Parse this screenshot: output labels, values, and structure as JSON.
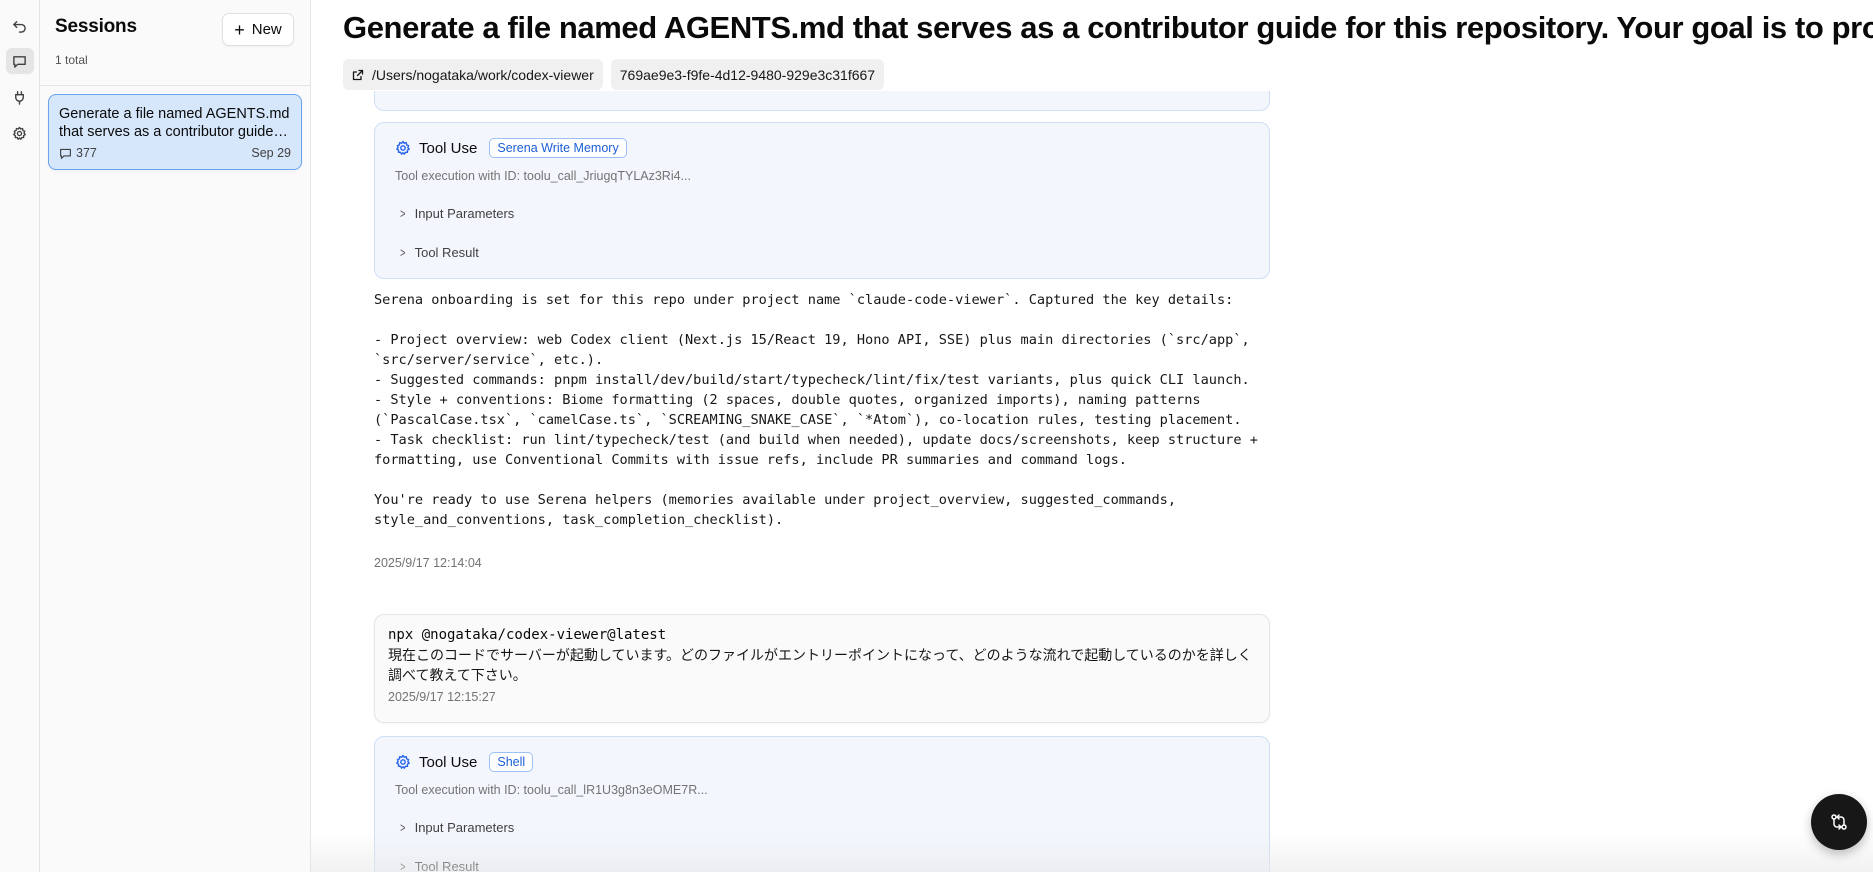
{
  "sidebar": {
    "title": "Sessions",
    "count": "1 total",
    "new_label": "New",
    "sessions": [
      {
        "title": "Generate a file named AGENTS.md that serves as a contributor guide for this repository. Your goal is to produce a clear, concise, and well-structured document",
        "message_count": "377",
        "date": "Sep 29"
      }
    ]
  },
  "header": {
    "title": "Generate a file named AGENTS.md that serves as a contributor guide for this repository. Your goal is to produce a clear, concise, and well-structured document",
    "path": "/Users/nogataka/work/codex-viewer",
    "session_id": "769ae9e3-f9fe-4d12-9480-929e3c31f667"
  },
  "messages": {
    "tool1": {
      "label": "Tool Use",
      "badge": "Serena Write Memory",
      "id_text": "Tool execution with ID: toolu_call_JriugqTYLAz3Ri4...",
      "input_label": "Input Parameters",
      "result_label": "Tool Result"
    },
    "assistant1": {
      "text": "Serena onboarding is set for this repo under project name `claude-code-viewer`. Captured the key details:\n\n- Project overview: web Codex client (Next.js 15/React 19, Hono API, SSE) plus main directories (`src/app`, `src/server/service`, etc.).\n- Suggested commands: pnpm install/dev/build/start/typecheck/lint/fix/test variants, plus quick CLI launch.\n- Style + conventions: Biome formatting (2 spaces, double quotes, organized imports), naming patterns (`PascalCase.tsx`, `camelCase.ts`, `SCREAMING_SNAKE_CASE`, `*Atom`), co-location rules, testing placement.\n- Task checklist: run lint/typecheck/test (and build when needed), update docs/screenshots, keep structure + formatting, use Conventional Commits with issue refs, include PR summaries and command logs.\n\nYou're ready to use Serena helpers (memories available under project_overview, suggested_commands, style_and_conventions, task_completion_checklist).",
      "time": "2025/9/17 12:14:04"
    },
    "user1": {
      "command": "npx @nogataka/codex-viewer@latest",
      "text": "現在このコードでサーバーが起動しています。どのファイルがエントリーポイントになって、どのような流れで起動しているのかを詳しく調べて教えて下さい。",
      "time": "2025/9/17 12:15:27"
    },
    "tool2": {
      "label": "Tool Use",
      "badge": "Shell",
      "id_text": "Tool execution with ID: toolu_call_lR1U3g8n3eOME7R...",
      "input_label": "Input Parameters",
      "result_label": "Tool Result"
    }
  },
  "icons": {
    "rail": [
      "undo-icon",
      "chat-icon",
      "plug-icon",
      "settings-icon"
    ],
    "fab": "git-compare-icon"
  },
  "colors": {
    "accent": "#2563eb",
    "selected_session_bg": "#d6e6fb",
    "selected_session_border": "#6aa3f0",
    "tool_card_bg": "#f3f7fd"
  }
}
